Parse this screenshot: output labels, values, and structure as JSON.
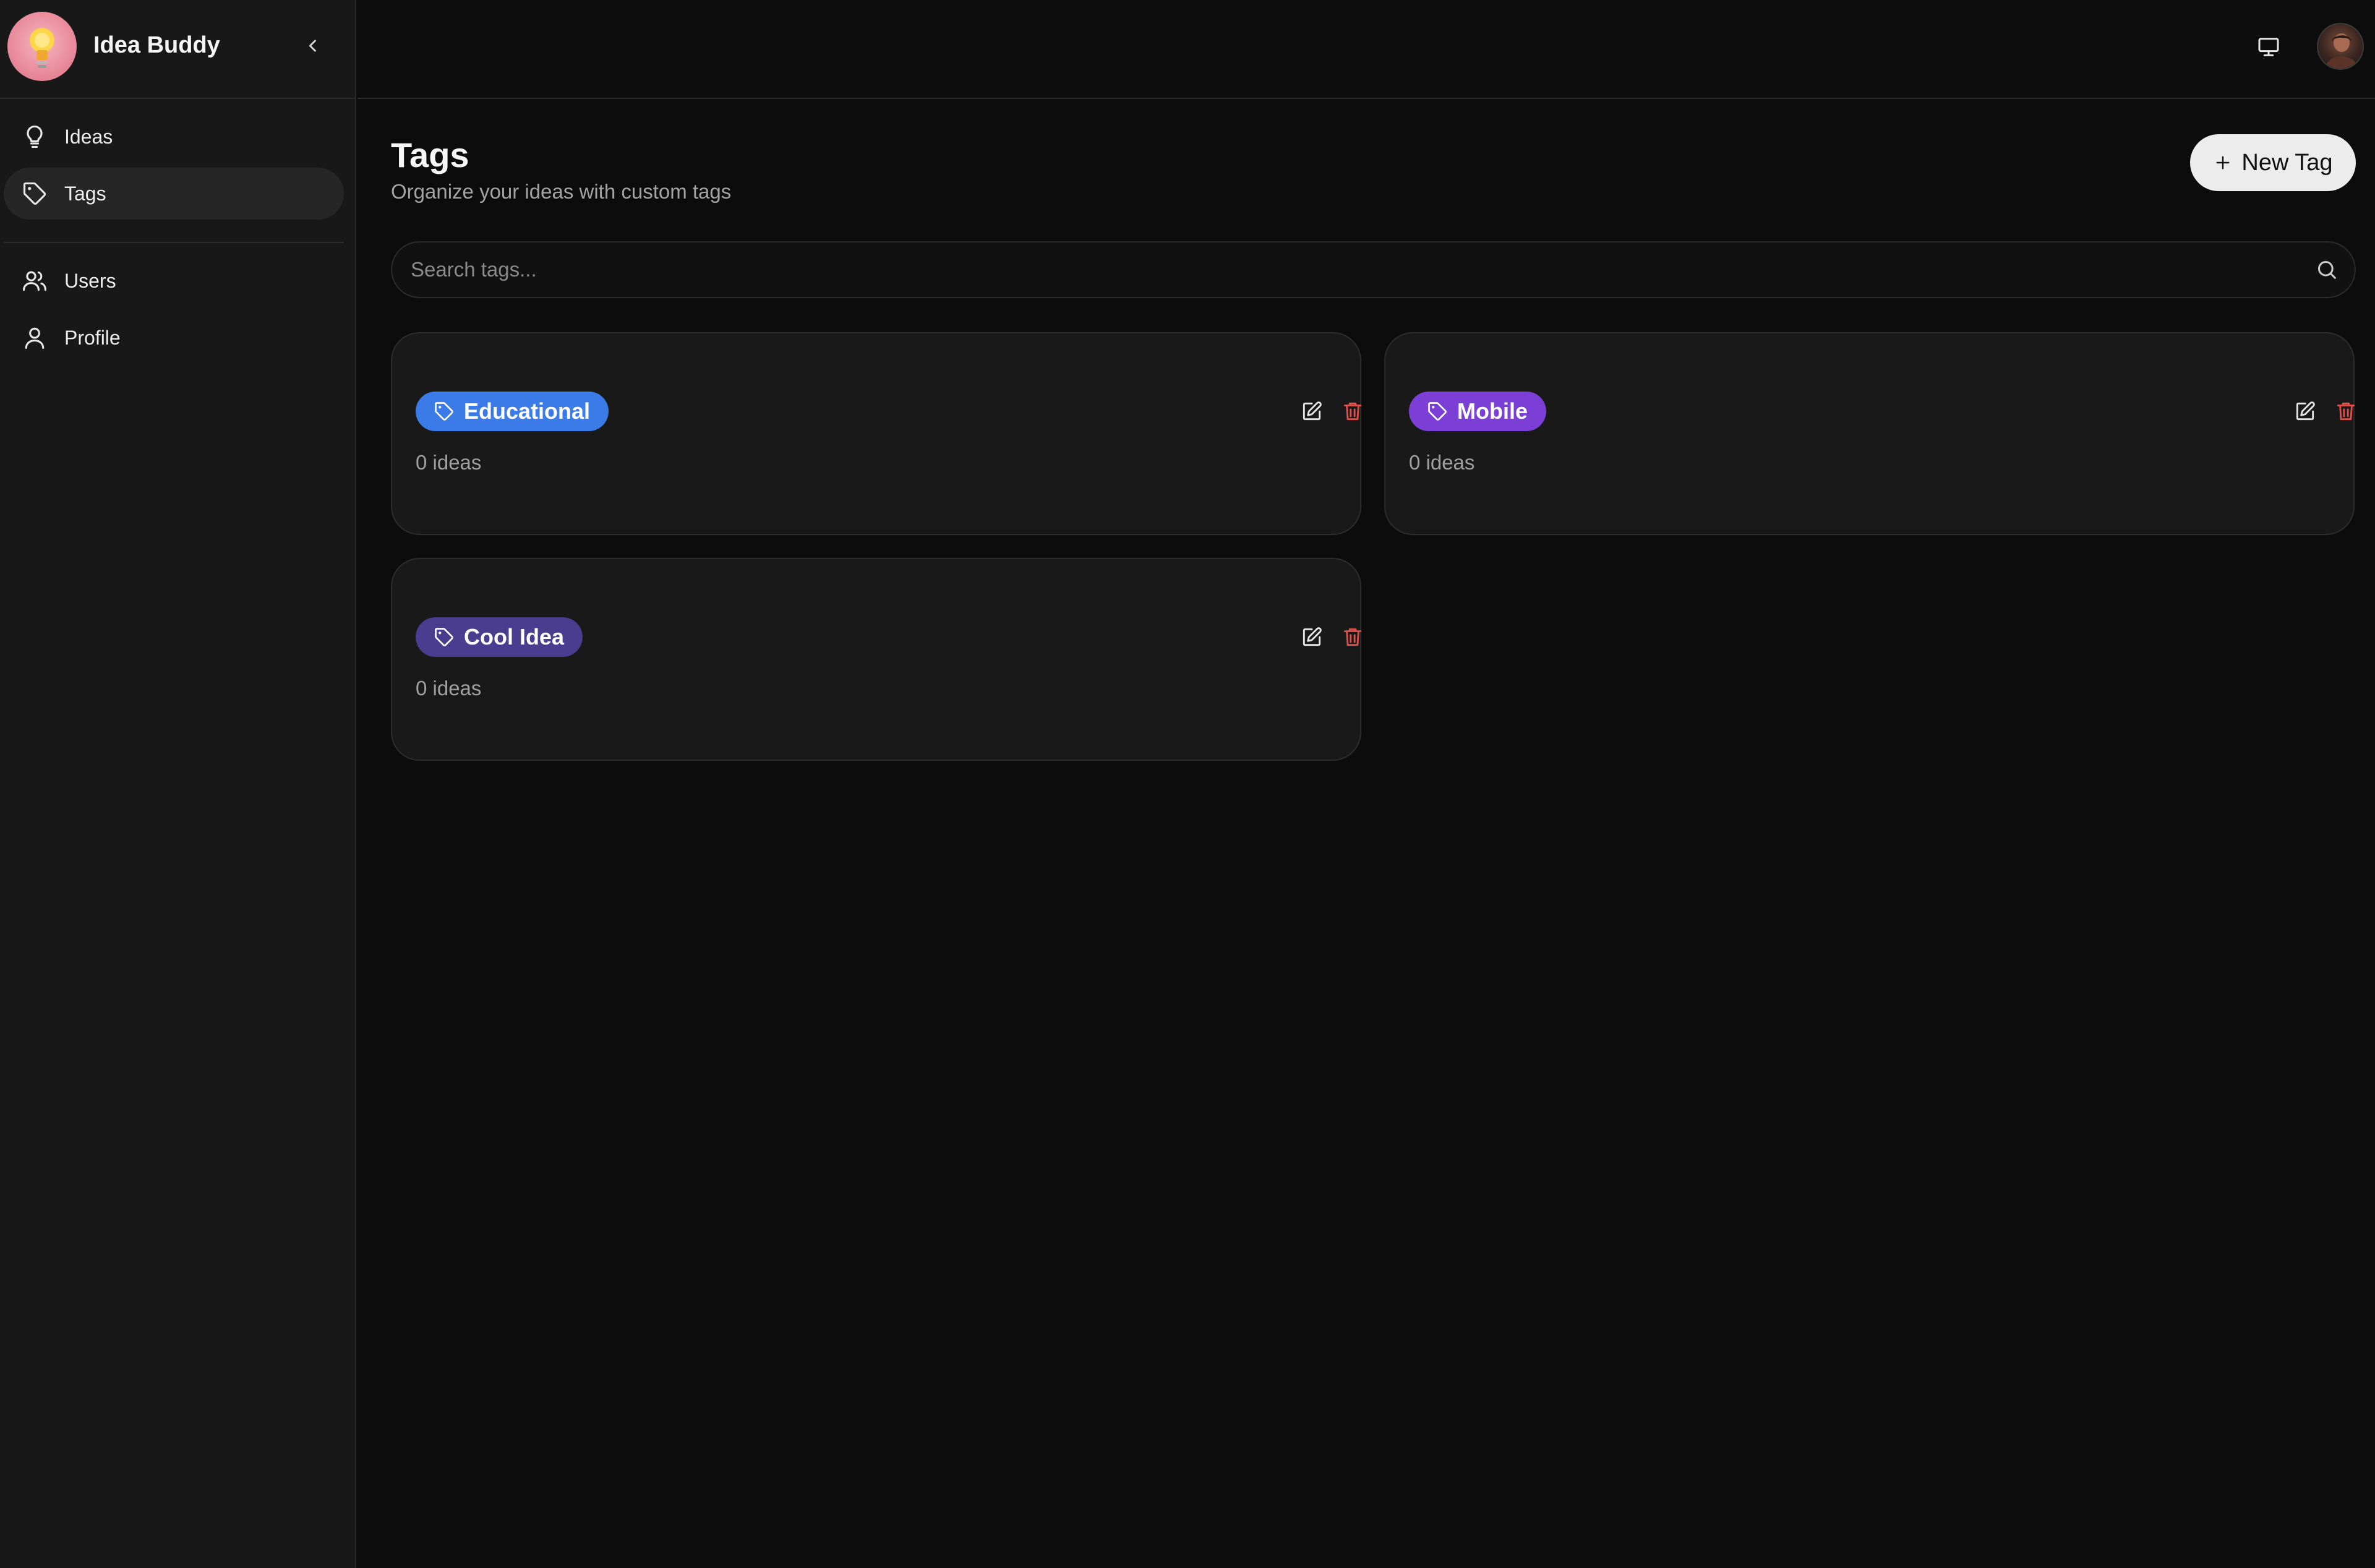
{
  "app": {
    "name": "Idea Buddy"
  },
  "sidebar": {
    "items": [
      {
        "label": "Ideas",
        "icon": "lightbulb-icon",
        "active": false
      },
      {
        "label": "Tags",
        "icon": "tag-icon",
        "active": true
      },
      {
        "label": "Users",
        "icon": "users-icon",
        "active": false
      },
      {
        "label": "Profile",
        "icon": "user-icon",
        "active": false
      }
    ]
  },
  "page": {
    "title": "Tags",
    "subtitle": "Organize your ideas with custom tags",
    "new_tag_label": "New Tag"
  },
  "search": {
    "placeholder": "Search tags...",
    "value": ""
  },
  "tags": [
    {
      "name": "Educational",
      "count_text": "0 ideas",
      "color": "#3b7be8"
    },
    {
      "name": "Mobile",
      "count_text": "0 ideas",
      "color": "#7b3fd6"
    },
    {
      "name": "Cool Idea",
      "count_text": "0 ideas",
      "color": "#4a3d8f"
    }
  ],
  "colors": {
    "background": "#0c0c0c",
    "sidebar": "#181818",
    "card": "#191919",
    "delete": "#e0504a"
  }
}
